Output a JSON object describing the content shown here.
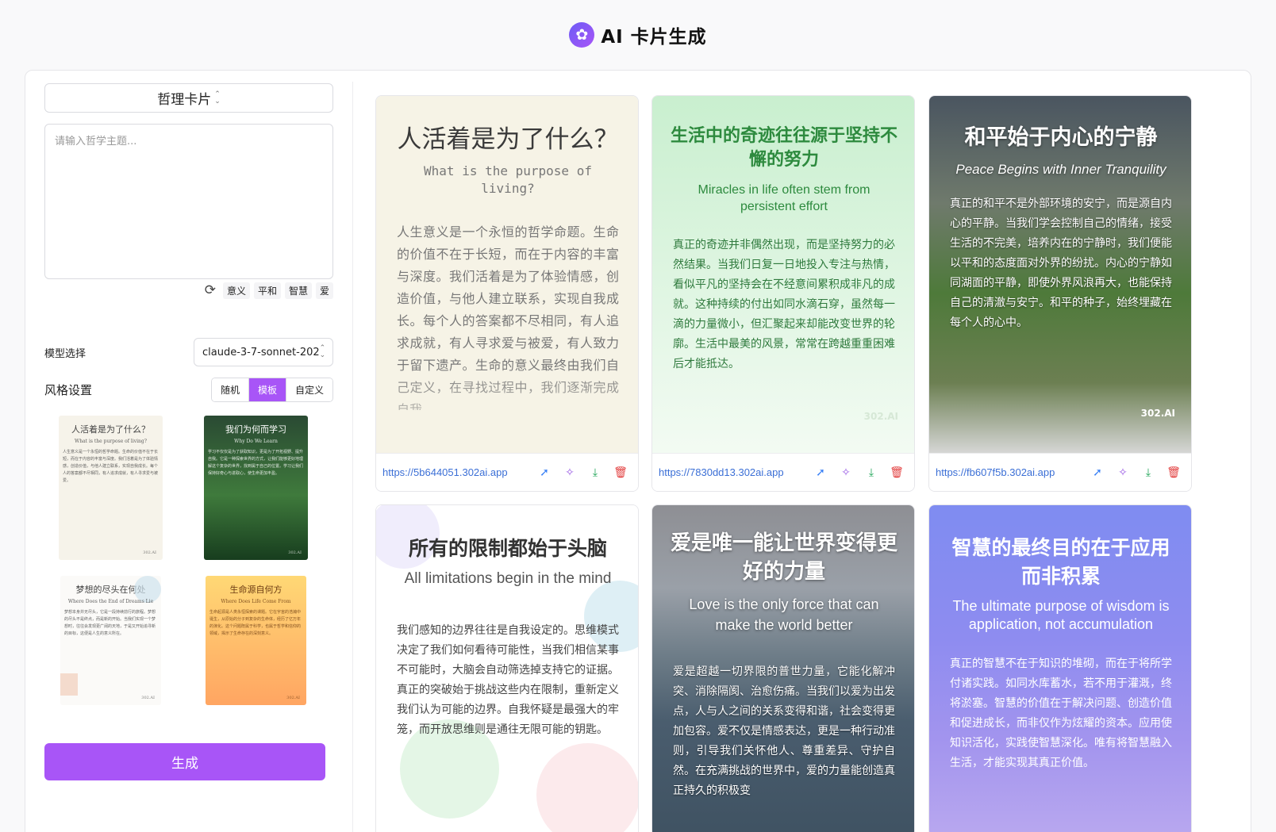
{
  "header": {
    "title": "AI 卡片生成",
    "logo_icon": "flower-icon"
  },
  "sidebar": {
    "card_type": "哲理卡片",
    "topic_placeholder": "请输入哲学主题...",
    "topic_value": "",
    "quick_topics": [
      "意义",
      "平和",
      "智慧",
      "爱"
    ],
    "model_label": "模型选择",
    "model_value": "claude-3-7-sonnet-202",
    "style_label": "风格设置",
    "style_modes": [
      "随机",
      "模板",
      "自定义"
    ],
    "active_style_mode": "模板",
    "templates": [
      {
        "title": "人活着是为了什么？",
        "subtitle": "What is the purpose of living?",
        "body": "人生意义是一个永恒的哲学命题。生命的价值不在于长短，而在于内容的丰富与深度。我们活着是为了体验情感，创造价值，与他人建立联系，实现自我成长。每个人的答案都不尽相同，有人追求成就，有人寻求爱与被爱。",
        "mark": "302.AI"
      },
      {
        "title": "我们为何而学习",
        "subtitle": "Why Do We Learn",
        "body": "学习不仅仅是为了获取知识，更是为了开拓视野、提升自我。它是一种探索世界的方式，让我们能够更好地理解这个复杂的世界，找到属于自己的位置。学习让我们保持好奇心与进取心，使生命更加丰盈。",
        "mark": "302.AI"
      },
      {
        "title": "梦想的尽头在何处",
        "subtitle": "Where Does the End of Dreams Lie",
        "body": "梦想本身并无尽头，它是一段持续前行的旅程。梦想的尽头不是终点，而是新的开始。当我们实现一个梦想时，往往会发现更广阔的天地，于是又开始追寻新的目标，这便是人生的意义所在。",
        "mark": "302.AI"
      },
      {
        "title": "生命源自何方",
        "subtitle": "Where Does Life Come From",
        "body": "生命起源是人类永恒探索的课题。它在宇宙的浩瀚中诞生，从原始的分子到复杂的生命体，经历了亿万年的演化。这个问题既属于科学，也属于哲学和信仰的领域，揭示了生命存在的深刻意义。",
        "mark": "302.AI"
      }
    ],
    "generate_label": "生成"
  },
  "cards": [
    {
      "title": "人活着是为了什么？",
      "subtitle": "What is the purpose of living?",
      "body": "人生意义是一个永恒的哲学命题。生命的价值不在于长短，而在于内容的丰富与深度。我们活着是为了体验情感，创造价值，与他人建立联系，实现自我成长。每个人的答案都不尽相同，有人追求成就，有人寻求爱与被爱，有人致力于留下遗产。生命的意义最终由我们自己定义，在寻找过程中，我们逐渐完成自我。",
      "mark": "",
      "url": "https://5b644051.302ai.app"
    },
    {
      "title": "生活中的奇迹往往源于坚持不懈的努力",
      "subtitle": "Miracles in life often stem from persistent effort",
      "body": "真正的奇迹并非偶然出现，而是坚持努力的必然结果。当我们日复一日地投入专注与热情，看似平凡的坚持会在不经意间累积成非凡的成就。这种持续的付出如同水滴石穿，虽然每一滴的力量微小，但汇聚起来却能改变世界的轮廓。生活中最美的风景，常常在跨越重重困难后才能抵达。",
      "mark": "302.AI",
      "url": "https://7830dd13.302ai.app"
    },
    {
      "title": "和平始于内心的宁静",
      "subtitle": "Peace Begins with Inner Tranquility",
      "body": "真正的和平不是外部环境的安宁，而是源自内心的平静。当我们学会控制自己的情绪，接受生活的不完美，培养内在的宁静时，我们便能以平和的态度面对外界的纷扰。内心的宁静如同湖面的平静，即使外界风浪再大，也能保持自己的清澈与安宁。和平的种子，始终埋藏在每个人的心中。",
      "mark": "302.AI",
      "url": "https://fb607f5b.302ai.app"
    },
    {
      "title": "所有的限制都始于头脑",
      "subtitle": "All limitations begin in the mind",
      "body": "我们感知的边界往往是自我设定的。思维模式决定了我们如何看待可能性，当我们相信某事不可能时，大脑会自动筛选掉支持它的证据。真正的突破始于挑战这些内在限制，重新定义我们认为可能的边界。自我怀疑是最强大的牢笼，而开放思维则是通往无限可能的钥匙。"
    },
    {
      "title": "爱是唯一能让世界变得更好的力量",
      "subtitle": "Love is the only force that can make the world better",
      "body": "爱是超越一切界限的普世力量，它能化解冲突、消除隔阂、治愈伤痛。当我们以爱为出发点，人与人之间的关系变得和谐，社会变得更加包容。爱不仅是情感表达，更是一种行动准则，引导我们关怀他人、尊重差异、守护自然。在充满挑战的世界中，爱的力量能创造真正持久的积极变"
    },
    {
      "title": "智慧的最终目的在于应用而非积累",
      "subtitle": "The ultimate purpose of wisdom is application, not accumulation",
      "body": "真正的智慧不在于知识的堆砌，而在于将所学付诸实践。如同水库蓄水，若不用于灌溉，终将淤塞。智慧的价值在于解决问题、创造价值和促进成长，而非仅作为炫耀的资本。应用使知识活化，实践使智慧深化。唯有将智慧融入生活，才能实现其真正价值。"
    }
  ],
  "colors": {
    "accent": "#a855f7",
    "link": "#3b6fd6"
  }
}
